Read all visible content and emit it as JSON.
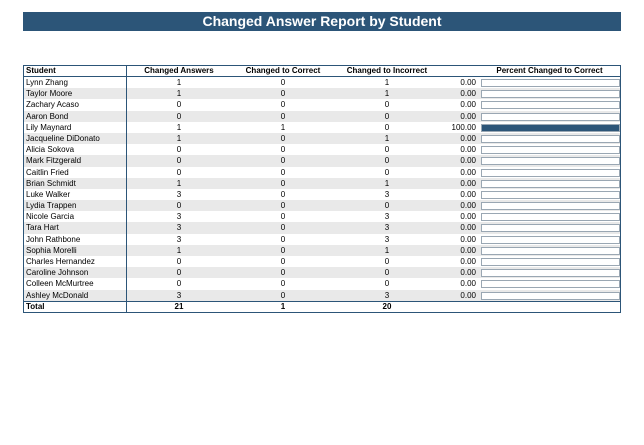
{
  "title": "Changed Answer Report by Student",
  "columns": [
    "Student",
    "Changed Answers",
    "Changed to Correct",
    "Changed to Incorrect",
    "Percent Changed to Correct"
  ],
  "rows": [
    {
      "name": "Lynn Zhang",
      "answers": "1",
      "correct": "0",
      "incorrect": "1",
      "percent": "0.00",
      "fraction": 0.0
    },
    {
      "name": "Taylor Moore",
      "answers": "1",
      "correct": "0",
      "incorrect": "1",
      "percent": "0.00",
      "fraction": 0.0
    },
    {
      "name": "Zachary Acaso",
      "answers": "0",
      "correct": "0",
      "incorrect": "0",
      "percent": "0.00",
      "fraction": 0.0
    },
    {
      "name": "Aaron Bond",
      "answers": "0",
      "correct": "0",
      "incorrect": "0",
      "percent": "0.00",
      "fraction": 0.0
    },
    {
      "name": "Lily Maynard",
      "answers": "1",
      "correct": "1",
      "incorrect": "0",
      "percent": "100.00",
      "fraction": 1.0
    },
    {
      "name": "Jacqueline DiDonato",
      "answers": "1",
      "correct": "0",
      "incorrect": "1",
      "percent": "0.00",
      "fraction": 0.0
    },
    {
      "name": "Alicia Sokova",
      "answers": "0",
      "correct": "0",
      "incorrect": "0",
      "percent": "0.00",
      "fraction": 0.0
    },
    {
      "name": "Mark Fitzgerald",
      "answers": "0",
      "correct": "0",
      "incorrect": "0",
      "percent": "0.00",
      "fraction": 0.0
    },
    {
      "name": "Caitlin Fried",
      "answers": "0",
      "correct": "0",
      "incorrect": "0",
      "percent": "0.00",
      "fraction": 0.0
    },
    {
      "name": "Brian Schmidt",
      "answers": "1",
      "correct": "0",
      "incorrect": "1",
      "percent": "0.00",
      "fraction": 0.0
    },
    {
      "name": "Luke Walker",
      "answers": "3",
      "correct": "0",
      "incorrect": "3",
      "percent": "0.00",
      "fraction": 0.0
    },
    {
      "name": "Lydia Trappen",
      "answers": "0",
      "correct": "0",
      "incorrect": "0",
      "percent": "0.00",
      "fraction": 0.0
    },
    {
      "name": "Nicole Garcia",
      "answers": "3",
      "correct": "0",
      "incorrect": "3",
      "percent": "0.00",
      "fraction": 0.0
    },
    {
      "name": "Tara Hart",
      "answers": "3",
      "correct": "0",
      "incorrect": "3",
      "percent": "0.00",
      "fraction": 0.0
    },
    {
      "name": "John Rathbone",
      "answers": "3",
      "correct": "0",
      "incorrect": "3",
      "percent": "0.00",
      "fraction": 0.0
    },
    {
      "name": "Sophia Morelli",
      "answers": "1",
      "correct": "0",
      "incorrect": "1",
      "percent": "0.00",
      "fraction": 0.0
    },
    {
      "name": "Charles Hernandez",
      "answers": "0",
      "correct": "0",
      "incorrect": "0",
      "percent": "0.00",
      "fraction": 0.0
    },
    {
      "name": "Caroline Johnson",
      "answers": "0",
      "correct": "0",
      "incorrect": "0",
      "percent": "0.00",
      "fraction": 0.0
    },
    {
      "name": "Colleen McMurtree",
      "answers": "0",
      "correct": "0",
      "incorrect": "0",
      "percent": "0.00",
      "fraction": 0.0
    },
    {
      "name": "Ashley McDonald",
      "answers": "3",
      "correct": "0",
      "incorrect": "3",
      "percent": "0.00",
      "fraction": 0.0
    }
  ],
  "total": {
    "label": "Total",
    "answers": "21",
    "correct": "1",
    "incorrect": "20"
  },
  "colors": {
    "accent": "#2c5578",
    "stripe": "#e9e9e9"
  }
}
